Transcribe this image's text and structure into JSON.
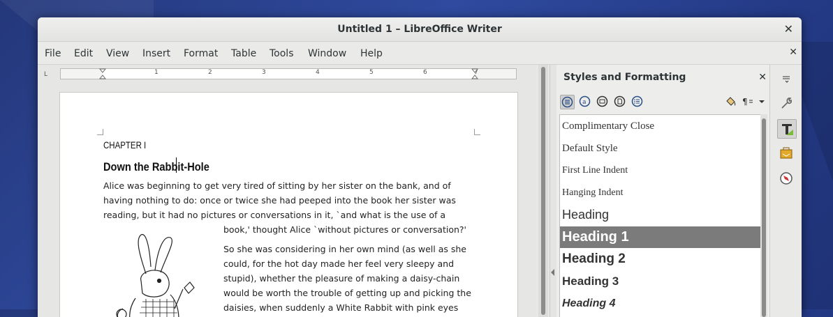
{
  "window": {
    "title": "Untitled 1 – LibreOffice Writer",
    "close_glyph": "✕"
  },
  "menu": [
    {
      "label": "File"
    },
    {
      "label": "Edit"
    },
    {
      "label": "View"
    },
    {
      "label": "Insert"
    },
    {
      "label": "Format"
    },
    {
      "label": "Table"
    },
    {
      "label": "Tools"
    },
    {
      "label": "Window"
    },
    {
      "label": "Help"
    }
  ],
  "ruler": {
    "numbers": [
      "1",
      "2",
      "3",
      "4",
      "5",
      "6",
      "7"
    ],
    "corner": "L"
  },
  "document": {
    "chapter": "CHAPTER I",
    "heading": "Down the Rabbit-Hole",
    "para1": [
      "Alice was beginning to get very tired of sitting by her sister on the bank, and of",
      "having nothing to do: once or twice she had peeped into the book her sister was",
      "reading, but it had no pictures or conversations in it, `and what is the use of a"
    ],
    "para1_end": "book,' thought Alice `without pictures or conversation?'",
    "para2": [
      "So she was considering in her own mind (as well as she",
      "could, for the hot day made her feel very sleepy and",
      "stupid), whether the pleasure of making a daisy-chain",
      "would be worth the trouble of getting up and picking the",
      "daisies, when suddenly a White Rabbit with pink eyes"
    ]
  },
  "sidebar": {
    "title": "Styles and Formatting",
    "close_glyph": "✕",
    "styles": [
      {
        "label": "Complimentary Close",
        "selected": false
      },
      {
        "label": "Default Style",
        "selected": false
      },
      {
        "label": "First Line Indent",
        "selected": false
      },
      {
        "label": "Hanging Indent",
        "selected": false
      },
      {
        "label": "Heading",
        "selected": false
      },
      {
        "label": "Heading 1",
        "selected": true
      },
      {
        "label": "Heading 2",
        "selected": false
      },
      {
        "label": "Heading 3",
        "selected": false
      },
      {
        "label": "Heading 4",
        "selected": false
      }
    ]
  },
  "colors": {
    "accent": "#2a4f86",
    "selection": "#7b7b7b"
  }
}
